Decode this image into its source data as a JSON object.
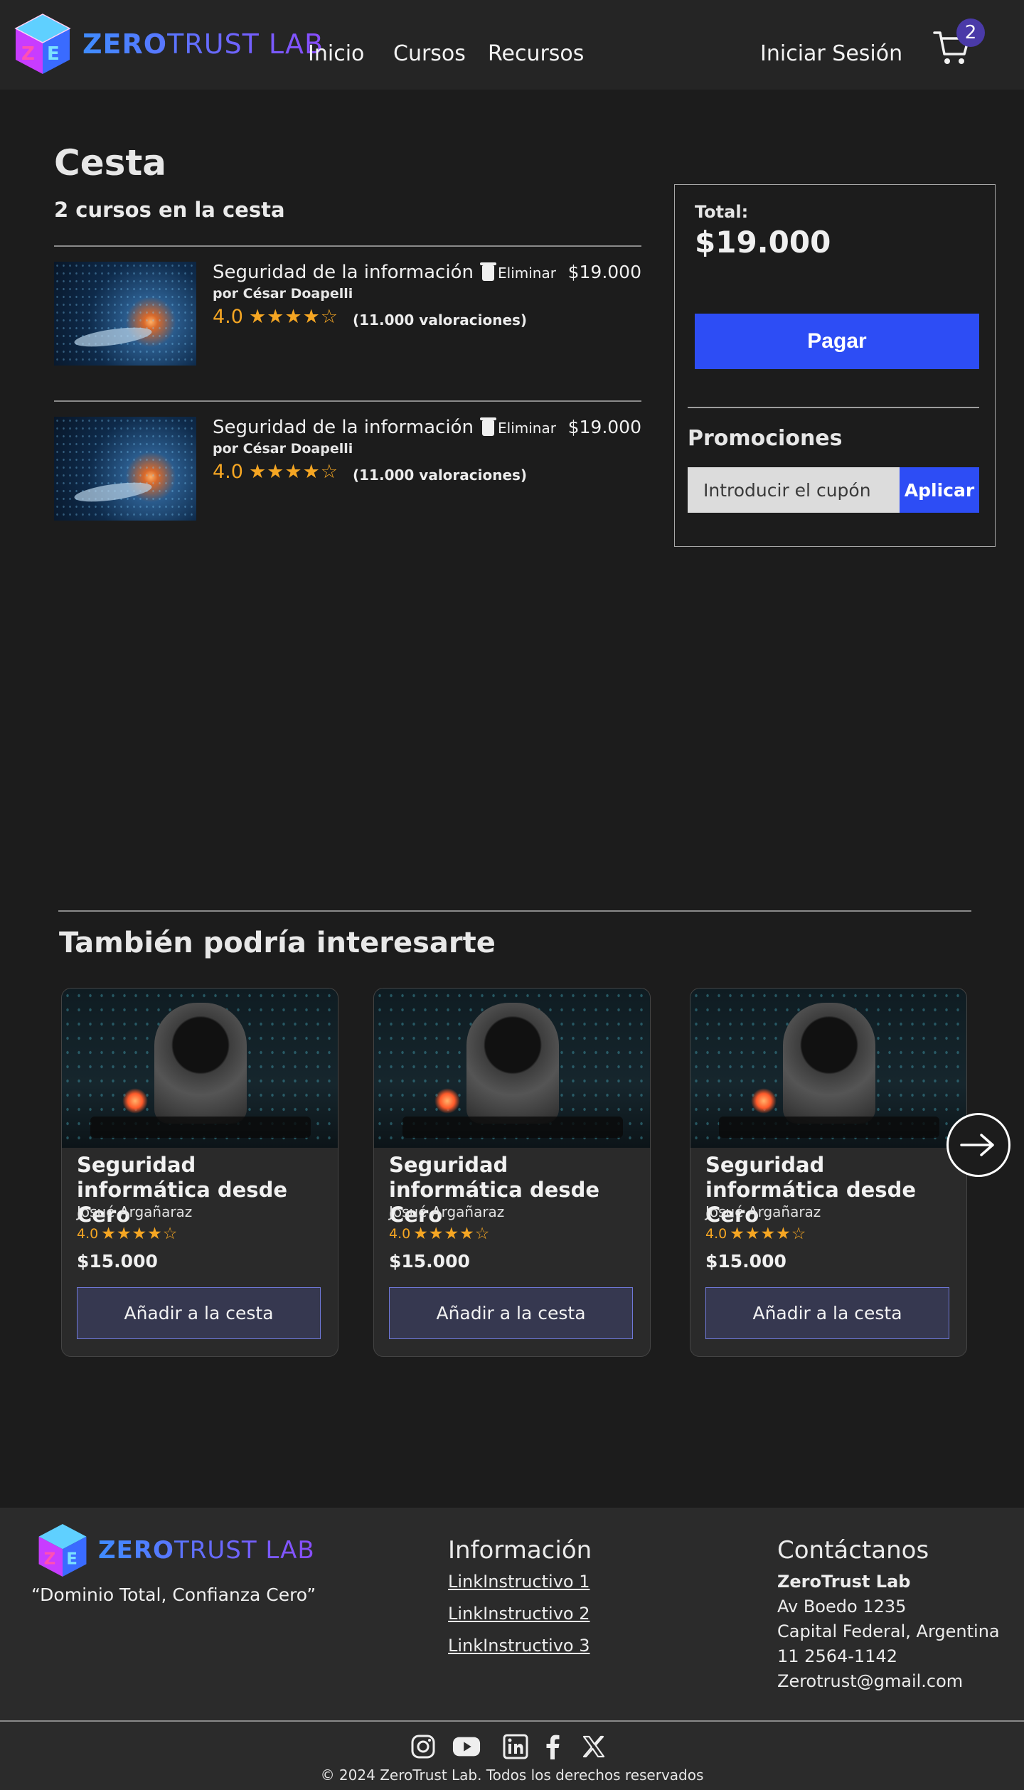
{
  "brand": {
    "logo_text_a": "ZERO",
    "logo_text_b": "TRUST LAB",
    "accent": "#2d4df5",
    "rating_color": "#f5a623"
  },
  "nav": {
    "links": [
      "Inicio",
      "Cursos",
      "Recursos"
    ],
    "login": "Iniciar Sesión",
    "cart_icon": "cart-icon",
    "cart_count": "2"
  },
  "cart": {
    "title": "Cesta",
    "count_text": "2 cursos en la cesta",
    "items": [
      {
        "title": "Seguridad de la información",
        "author": "por César Doapelli",
        "rating": "4.0",
        "stars": "★★★★☆",
        "reviews": "(11.000 valoraciones)",
        "remove_label": "Eliminar",
        "price": "$19.000"
      },
      {
        "title": "Seguridad de la información",
        "author": "por César Doapelli",
        "rating": "4.0",
        "stars": "★★★★☆",
        "reviews": "(11.000 valoraciones)",
        "remove_label": "Eliminar",
        "price": "$19.000"
      }
    ]
  },
  "summary": {
    "total_label": "Total:",
    "total_value": "$19.000",
    "pay_label": "Pagar",
    "promo_title": "Promociones",
    "coupon_placeholder": "Introducir el cupón",
    "apply_label": "Aplicar"
  },
  "recommendations": {
    "title": "También podría interesarte",
    "cards": [
      {
        "title": "Seguridad informática desde Cero",
        "author": "Josué Argañaraz",
        "rating": "4.0",
        "stars": "★★★★☆",
        "price": "$15.000",
        "button": "Añadir a la cesta"
      },
      {
        "title": "Seguridad informática desde Cero",
        "author": "Josué Argañaraz",
        "rating": "4.0",
        "stars": "★★★★☆",
        "price": "$15.000",
        "button": "Añadir a la cesta"
      },
      {
        "title": "Seguridad informática desde Cero",
        "author": "Josué Argañaraz",
        "rating": "4.0",
        "stars": "★★★★☆",
        "price": "$15.000",
        "button": "Añadir a la cesta"
      }
    ],
    "next_icon": "arrow-right-icon"
  },
  "footer": {
    "tagline": "“Dominio Total, Confianza Cero”",
    "info_title": "Información",
    "info_links": [
      "LinkInstructivo 1",
      "LinkInstructivo 2",
      "LinkInstructivo 3"
    ],
    "contact_title": "Contáctanos",
    "contact_name": "ZeroTrust Lab",
    "contact_lines": [
      "Av Boedo 1235",
      "Capital Federal, Argentina",
      "11 2564-1142",
      "Zerotrust@gmail.com"
    ],
    "social_icons": [
      "instagram-icon",
      "youtube-icon",
      "linkedin-icon",
      "facebook-icon",
      "x-icon"
    ],
    "copyright": "© 2024 ZeroTrust Lab. Todos los derechos reservados"
  }
}
